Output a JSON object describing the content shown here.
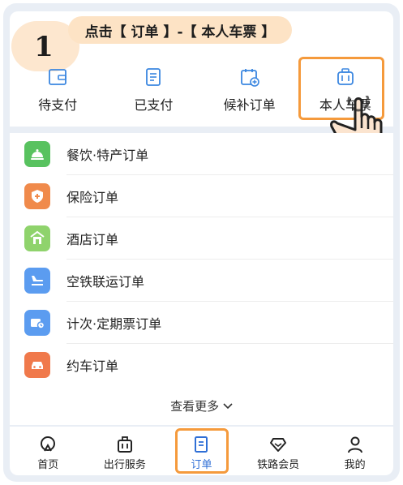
{
  "step": {
    "number": "1",
    "instruction": "点击【 订单 】-【 本人车票 】"
  },
  "tabs": [
    {
      "label": "待支付",
      "icon": "wallet-icon"
    },
    {
      "label": "已支付",
      "icon": "receipt-icon"
    },
    {
      "label": "候补订单",
      "icon": "calendar-plus-icon"
    },
    {
      "label": "本人车票",
      "icon": "suitcase-icon"
    }
  ],
  "orders": [
    {
      "label": "餐饮·特产订单",
      "icon": "bell-dish-icon",
      "color": "#58c25f"
    },
    {
      "label": "保险订单",
      "icon": "shield-plus-icon",
      "color": "#f08a4b"
    },
    {
      "label": "酒店订单",
      "icon": "hotel-icon",
      "color": "#8fd36c"
    },
    {
      "label": "空铁联运订单",
      "icon": "plane-train-icon",
      "color": "#5b9cf0"
    },
    {
      "label": "计次·定期票订单",
      "icon": "ticket-clock-icon",
      "color": "#5b9cf0"
    },
    {
      "label": "约车订单",
      "icon": "car-icon",
      "color": "#f0794b"
    }
  ],
  "more": {
    "label": "查看更多"
  },
  "bottom_nav": [
    {
      "label": "首页",
      "icon": "home-icon"
    },
    {
      "label": "出行服务",
      "icon": "luggage-icon"
    },
    {
      "label": "订单",
      "icon": "order-doc-icon"
    },
    {
      "label": "铁路会员",
      "icon": "diamond-icon"
    },
    {
      "label": "我的",
      "icon": "person-icon"
    }
  ],
  "colors": {
    "accent": "#2f6fd6",
    "highlight": "#f59a3c",
    "background": "#e9eef5"
  }
}
